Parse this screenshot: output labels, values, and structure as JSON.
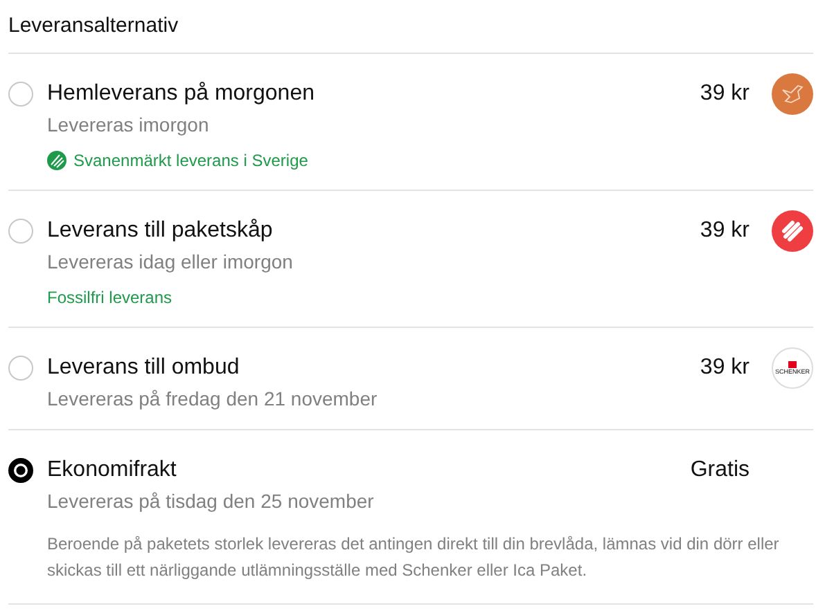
{
  "heading": "Leveransalternativ",
  "options": [
    {
      "title": "Hemleverans på morgonen",
      "subtitle": "Levereras imorgon",
      "price": "39 kr",
      "selected": false,
      "logo": {
        "kind": "bird"
      },
      "note": {
        "text": "Svanenmärkt leverans i Sverige",
        "kind": "swan"
      }
    },
    {
      "title": "Leverans till paketskåp",
      "subtitle": "Levereras idag eller imorgon",
      "price": "39 kr",
      "selected": false,
      "logo": {
        "kind": "stripes"
      },
      "note": {
        "text": "Fossilfri leverans"
      }
    },
    {
      "title": "Leverans till ombud",
      "subtitle": "Levereras på fredag den 21 november",
      "price": "39 kr",
      "selected": false,
      "logo": {
        "kind": "schenker",
        "text": "SCHENKER"
      }
    },
    {
      "title": "Ekonomifrakt",
      "subtitle": "Levereras på tisdag den 25 november",
      "price": "Gratis",
      "selected": true,
      "description": "Beroende på paketets storlek levereras det antingen direkt till din brevlåda, lämnas vid din dörr eller skickas till ett närliggande utlämningsställe med Schenker eller Ica Paket."
    }
  ]
}
